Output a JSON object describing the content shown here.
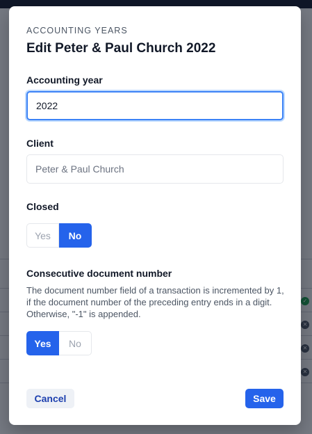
{
  "modal": {
    "eyebrow": "ACCOUNTING YEARS",
    "title": "Edit Peter & Paul Church 2022",
    "accounting_year": {
      "label": "Accounting year",
      "value": "2022"
    },
    "client": {
      "label": "Client",
      "value": "Peter & Paul Church"
    },
    "closed": {
      "label": "Closed",
      "yes": "Yes",
      "no": "No",
      "selected": "No"
    },
    "consecutive": {
      "label": "Consecutive document number",
      "description": "The document number field of a transaction is incremented by 1, if the document number of the preceding entry ends in a digit. Otherwise, \"-1\" is appended.",
      "yes": "Yes",
      "no": "No",
      "selected": "Yes"
    },
    "cancel_label": "Cancel",
    "save_label": "Save"
  },
  "colors": {
    "primary": "#2563eb",
    "focus_ring": "#3b82f6"
  }
}
